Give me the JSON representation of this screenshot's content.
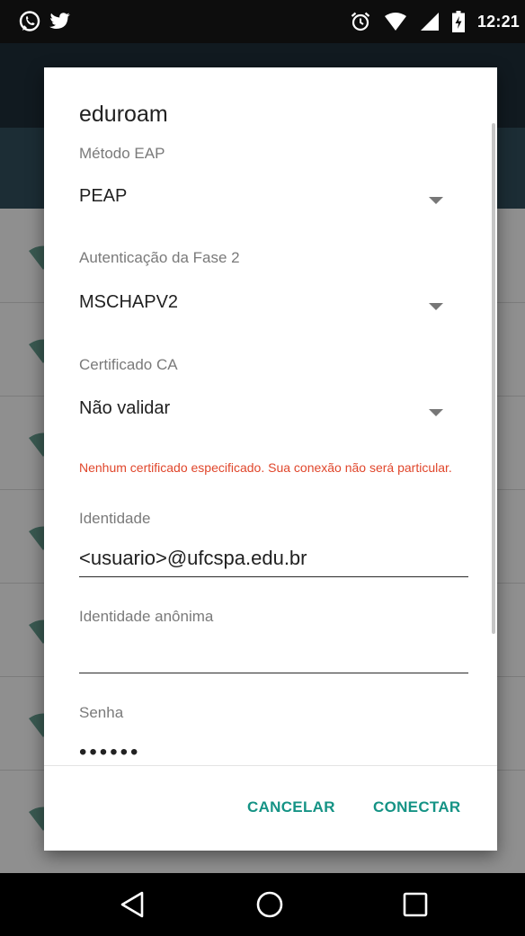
{
  "status_bar": {
    "left_icons": [
      "whatsapp-icon",
      "twitter-icon"
    ],
    "right_icons": [
      "alarm-icon",
      "wifi-signal-icon",
      "cell-signal-icon",
      "battery-charging-icon"
    ],
    "time": "12:21"
  },
  "dialog": {
    "title": "eduroam",
    "eap_method": {
      "label": "Método EAP",
      "value": "PEAP"
    },
    "phase2": {
      "label": "Autenticação da Fase 2",
      "value": "MSCHAPV2"
    },
    "ca_cert": {
      "label": "Certificado CA",
      "value": "Não validar"
    },
    "warning": "Nenhum certificado especificado. Sua conexão não será particular.",
    "identity": {
      "label": "Identidade",
      "value": "<usuario>@ufcspa.edu.br"
    },
    "anonymous_identity": {
      "label": "Identidade anônima",
      "value": ""
    },
    "password": {
      "label": "Senha",
      "value": "••••••"
    },
    "cancel_label": "CANCELAR",
    "connect_label": "CONECTAR"
  },
  "colors": {
    "accent": "#159385",
    "warning": "#e0462b",
    "toolbar": "#111a20",
    "subheader": "#1c2d35",
    "scrim": "#8f8f8f"
  },
  "nav_bar": {
    "buttons": [
      "back-icon",
      "home-icon",
      "recents-icon"
    ]
  }
}
